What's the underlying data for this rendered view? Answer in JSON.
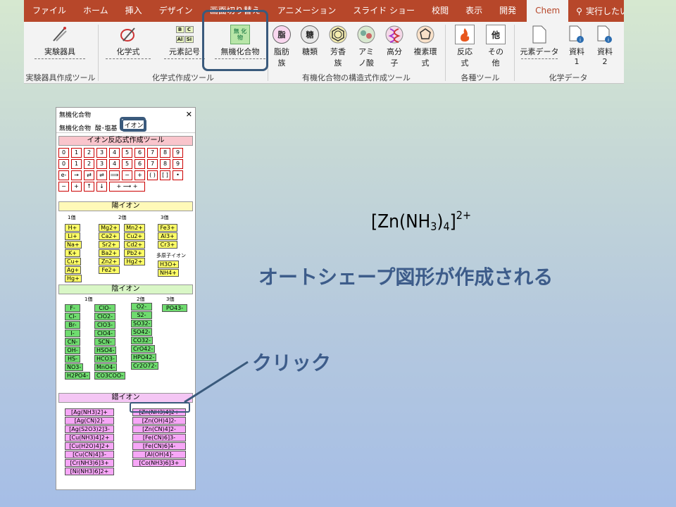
{
  "ribbon": {
    "tabs": [
      "ファイル",
      "ホーム",
      "挿入",
      "デザイン",
      "画面切り替え",
      "アニメーション",
      "スライド ショー",
      "校閲",
      "表示",
      "開発",
      "Chem"
    ],
    "active_tab": "Chem",
    "tellme": "実行したい作業を",
    "buttons": {
      "jikken": "実験器具",
      "kagakushiki": "化学式",
      "genso": "元素記号",
      "muki": "無機化合物",
      "muki_icon": "無 化物",
      "shibou": "脂肪族",
      "touri": "糖類",
      "houkou": "芳香族",
      "amino": "アミノ酸",
      "koubunshi": "高分子",
      "fukuso": "複素環式",
      "hannou": "反応式",
      "sonota": "その他",
      "genso_data": "元素データ",
      "shiryo1": "資料1",
      "shiryo2": "資料2"
    },
    "icon_labels": {
      "shibou": "脂",
      "touri": "糖",
      "sonota": "他",
      "genso_b": "B",
      "genso_c": "C",
      "genso_al": "Al",
      "genso_si": "Si"
    },
    "groups": {
      "g1": "実験器具作成ツール",
      "g2": "化学式作成ツール",
      "g3": "有機化合物の構造式作成ツール",
      "g4": "各種ツール",
      "g5": "化学データ"
    }
  },
  "panel": {
    "title": "無機化合物",
    "close": "✕",
    "tabs": [
      "無機化合物",
      "酸･塩基",
      "イオン"
    ],
    "sections": {
      "reaction": "イオン反応式作成ツール",
      "cation": "陽イオン",
      "anion": "陰イオン",
      "complex": "錯イオン"
    },
    "keys_row1": [
      "0",
      "1",
      "2",
      "3",
      "4",
      "5",
      "6",
      "7",
      "8",
      "9"
    ],
    "keys_row2": [
      "0",
      "1",
      "2",
      "3",
      "4",
      "5",
      "6",
      "7",
      "8",
      "9"
    ],
    "keys_row3": [
      "e-",
      "→",
      "⇄",
      "⇌",
      "⟹",
      "−",
      "+",
      "( )",
      "[ ]",
      "•"
    ],
    "keys_row4": [
      "−",
      "+",
      "↑",
      "↓",
      "+ ⟶ +"
    ],
    "valence": {
      "v1": "1価",
      "v2": "2価",
      "v3": "3価",
      "poly": "多原子イオン"
    },
    "cations_1": [
      "H+",
      "Li+",
      "Na+",
      "K+",
      "Cu+",
      "Ag+",
      "Hg+"
    ],
    "cations_2a": [
      "Mg2+",
      "Ca2+",
      "Sr2+",
      "Ba2+",
      "Zn2+",
      "Fe2+"
    ],
    "cations_2b": [
      "Mn2+",
      "Cu2+",
      "Cd2+",
      "Pb2+",
      "Hg2+"
    ],
    "cations_3": [
      "Fe3+",
      "Al3+",
      "Cr3+"
    ],
    "cations_poly": [
      "H3O+",
      "NH4+"
    ],
    "anions_1a": [
      "F-",
      "Cl-",
      "Br-",
      "I-",
      "CN-",
      "OH-",
      "HS-",
      "NO3-",
      "H2PO4-"
    ],
    "anions_1b": [
      "ClO-",
      "ClO2-",
      "ClO3-",
      "ClO4-",
      "SCN-",
      "HSO4-",
      "HCO3-",
      "MnO4-",
      "CO3COO-"
    ],
    "anions_2": [
      "O2-",
      "S2-",
      "SO32-",
      "SO42-",
      "CO32-",
      "CrO42-",
      "HPO42-",
      "Cr2O72-"
    ],
    "anions_3": [
      "PO43-"
    ],
    "complex_a": [
      "[Ag(NH3)2]+",
      "[Ag(CN)2]-",
      "[Ag(S2O3)2]3-",
      "[Cu(NH3)4]2+",
      "[Cu(H2O)4]2+",
      "[Cu(CN)4]3-",
      "[Cr(NH3)6]3+",
      "[Ni(NH3)6]2+"
    ],
    "complex_b": [
      "[Zn(NH3)4]2+",
      "[Zn(OH)4]2-",
      "[Zn(CN)4]2-",
      "[Fe(CN)6]3-",
      "[Fe(CN)6]4-",
      "[Al(OH)4]-",
      "[Co(NH3)6]3+"
    ]
  },
  "slide": {
    "formula_main": "[Zn(NH",
    "formula_sub3": "3",
    "formula_close": ")",
    "formula_sub4": "4",
    "formula_end": "]",
    "formula_sup": "2+",
    "note_created": "オートシェープ図形が作成される",
    "note_click": "クリック"
  },
  "colors": {
    "accent": "#b7472a",
    "highlight": "#3a5a7c"
  }
}
